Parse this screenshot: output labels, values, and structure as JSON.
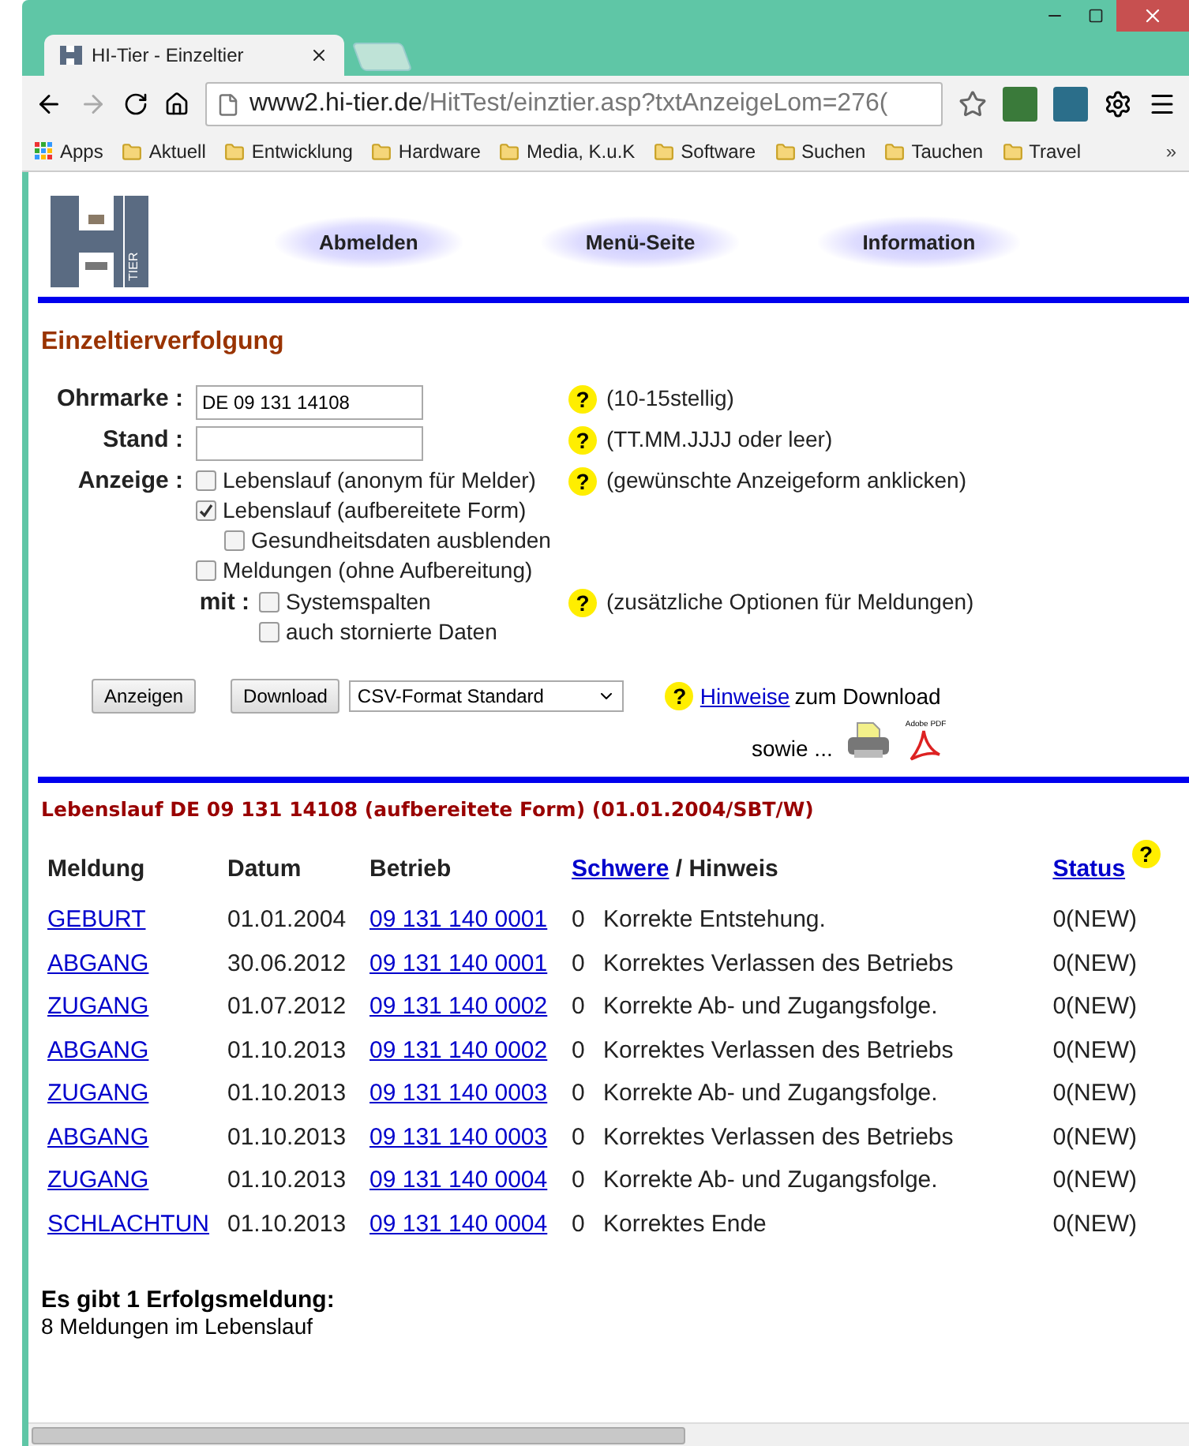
{
  "browser": {
    "tabs": [
      {
        "title": "HI-Tier - Einzeltier",
        "selected": true
      }
    ],
    "url": {
      "host": "www2.hi-tier.de",
      "path": "/HitTest/einztier.asp?txtAnzeigeLom=276("
    },
    "bookmarks": [
      "Apps",
      "Aktuell",
      "Entwicklung",
      "Hardware",
      "Media, K.u.K",
      "Software",
      "Suchen",
      "Tauchen",
      "Travel"
    ],
    "bookmarks_more": "»"
  },
  "page": {
    "logo": {
      "text": "TIER"
    },
    "nav": [
      "Abmelden",
      "Menü-Seite",
      "Information"
    ],
    "heading": "Einzeltierverfolgung",
    "form": {
      "ohrmarke": {
        "label": "Ohrmarke :",
        "value": "DE 09 131 14108",
        "help": "?",
        "hint": "(10-15stellig)"
      },
      "stand": {
        "label": "Stand :",
        "help": "?",
        "hint": "(TT.MM.JJJJ oder leer)"
      },
      "anzeige": {
        "label": "Anzeige :",
        "help": "?",
        "hint": "(gewünschte Anzeigeform anklicken)",
        "options": [
          {
            "label": "Lebenslauf (anonym für Melder)",
            "checked": false
          },
          {
            "label": "Lebenslauf (aufbereitete Form)",
            "checked": true,
            "children": [
              {
                "label": "Gesundheitsdaten ausblenden",
                "checked": false
              }
            ]
          },
          {
            "label": "Meldungen (ohne Aufbereitung)",
            "checked": false
          }
        ]
      },
      "mit": {
        "label": "mit :",
        "help": "?",
        "hint": "(zusätzliche Optionen für Meldungen)",
        "options": [
          {
            "label": "Systemspalten",
            "checked": false
          },
          {
            "label": "auch stornierte Daten",
            "checked": false
          }
        ]
      },
      "buttons": [
        "Anzeigen",
        "Download"
      ],
      "format": "CSV-Format Standard",
      "download_help": "?",
      "download_link": "Hinweise",
      "download_text": "zum Download",
      "also": "sowie ...",
      "pdf_label": "Adobe PDF"
    },
    "result_title": "Lebenslauf DE 09 131 14108 (aufbereitete Form) (01.01.2004/SBT/W)",
    "table": {
      "columns": {
        "meldung": "Meldung",
        "datum": "Datum",
        "betrieb": "Betrieb",
        "schwere": "Schwere",
        "hinweis": "/ Hinweis",
        "status": "Status",
        "status_help": "?"
      },
      "rows": [
        {
          "meldung": "GEBURT",
          "datum": "01.01.2004",
          "betrieb": "09 131 140 0001",
          "schwere": "0",
          "hinweis": "Korrekte Entstehung.",
          "status": "0(NEW)"
        },
        {
          "meldung": "ABGANG",
          "datum": "30.06.2012",
          "betrieb": "09 131 140 0001",
          "schwere": "0",
          "hinweis": "Korrektes Verlassen des Betriebs",
          "status": "0(NEW)"
        },
        {
          "meldung": "ZUGANG",
          "datum": "01.07.2012",
          "betrieb": "09 131 140 0002",
          "schwere": "0",
          "hinweis": "Korrekte Ab- und Zugangsfolge.",
          "status": "0(NEW)"
        },
        {
          "meldung": "ABGANG",
          "datum": "01.10.2013",
          "betrieb": "09 131 140 0002",
          "schwere": "0",
          "hinweis": "Korrektes Verlassen des Betriebs",
          "status": "0(NEW)"
        },
        {
          "meldung": "ZUGANG",
          "datum": "01.10.2013",
          "betrieb": "09 131 140 0003",
          "schwere": "0",
          "hinweis": "Korrekte Ab- und Zugangsfolge.",
          "status": "0(NEW)"
        },
        {
          "meldung": "ABGANG",
          "datum": "01.10.2013",
          "betrieb": "09 131 140 0003",
          "schwere": "0",
          "hinweis": "Korrektes Verlassen des Betriebs",
          "status": "0(NEW)"
        },
        {
          "meldung": "ZUGANG",
          "datum": "01.10.2013",
          "betrieb": "09 131 140 0004",
          "schwere": "0",
          "hinweis": "Korrekte Ab- und Zugangsfolge.",
          "status": "0(NEW)"
        },
        {
          "meldung": "SCHLACHTUN",
          "datum": "01.10.2013",
          "betrieb": "09 131 140 0004",
          "schwere": "0",
          "hinweis": "Korrektes Ende",
          "status": "0(NEW)"
        }
      ]
    },
    "summary_title": "Es gibt 1 Erfolgsmeldung:",
    "summary_text": "8 Meldungen im Lebenslauf"
  }
}
